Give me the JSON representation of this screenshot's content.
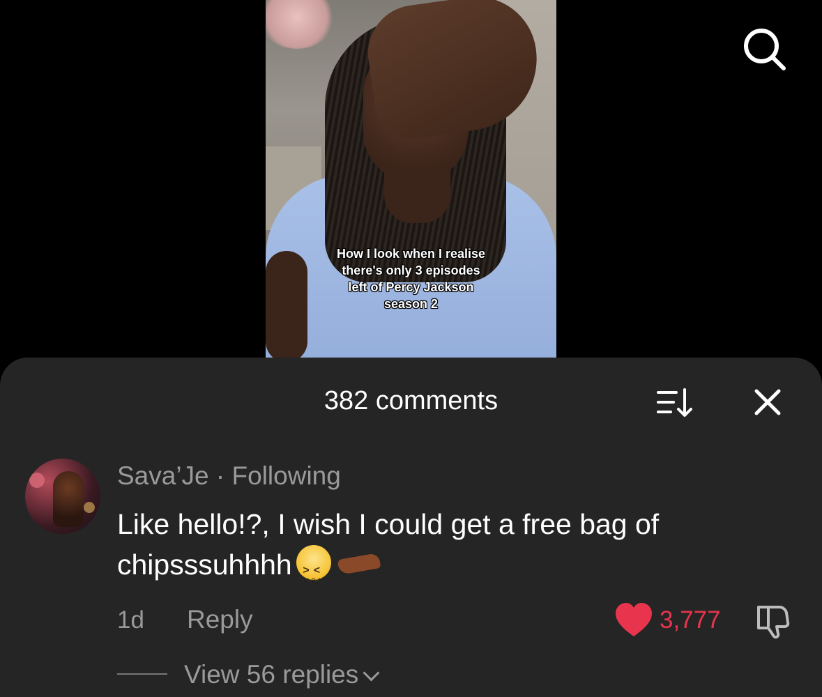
{
  "video": {
    "caption": "How I look when I realise\nthere's only 3 episodes\nleft of Percy Jackson\nseason 2"
  },
  "icons": {
    "search": "search-icon",
    "sort": "sort-icon",
    "close": "close-icon",
    "like": "heart-icon",
    "dislike": "thumbs-down-icon"
  },
  "comments_sheet": {
    "title": "382 comments",
    "comment": {
      "author": "Sava’Je",
      "separator": " · ",
      "relationship": "Following",
      "text": "Like hello!?, I wish I could get a free bag of chipsssuhhhh",
      "emoji_1": "confounded-face",
      "emoji_2": "palm-up-hand",
      "age": "1d",
      "reply_label": "Reply",
      "like_count": "3,777",
      "view_replies": "View 56 replies"
    }
  },
  "colors": {
    "sheet_bg": "#252525",
    "like": "#e8354d",
    "muted_text": "#9a9a9a"
  }
}
